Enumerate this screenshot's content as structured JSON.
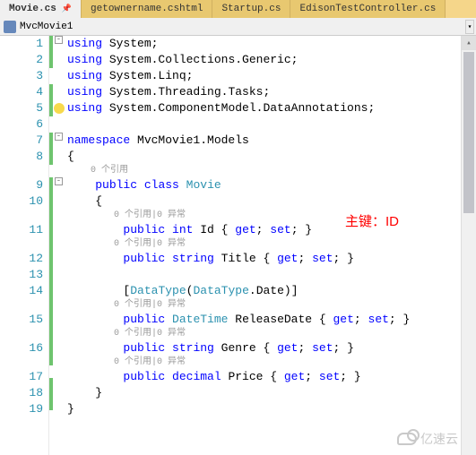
{
  "tabs": [
    {
      "label": "Movie.cs",
      "active": true,
      "pinned": true
    },
    {
      "label": "getownername.cshtml",
      "active": false,
      "pinned": false
    },
    {
      "label": "Startup.cs",
      "active": false,
      "pinned": false
    },
    {
      "label": "EdisonTestController.cs",
      "active": false,
      "pinned": false
    }
  ],
  "breadcrumb": {
    "project": "MvcMovie1"
  },
  "annotation": "主键：ID",
  "watermark": "亿速云",
  "lens": {
    "ref0": "0 个引用",
    "refex": "0 个引用|0 异常"
  },
  "code": {
    "l1": {
      "kw": "using",
      "ns": " System;"
    },
    "l2": {
      "kw": "using",
      "ns": " System.Collections.Generic;"
    },
    "l3": {
      "kw": "using",
      "ns": " System.Linq;"
    },
    "l4": {
      "kw": "using",
      "ns": " System.Threading.Tasks;"
    },
    "l5": {
      "kw": "using",
      "ns": " System.ComponentModel.DataAnnotations;"
    },
    "l7a": "namespace",
    "l7b": " MvcMovie1.Models",
    "l8": "{",
    "l9a": "public",
    "l9b": "class",
    "l9c": "Movie",
    "l10": "{",
    "l11a": "public",
    "l11b": "int",
    "l11c": " Id { ",
    "l11d": "get",
    "l11e": "; ",
    "l11f": "set",
    "l11g": "; }",
    "l12a": "public",
    "l12b": "string",
    "l12c": " Title { ",
    "l12d": "get",
    "l12e": "; ",
    "l12f": "set",
    "l12g": "; }",
    "l14a": "[",
    "l14b": "DataType",
    "l14c": "(",
    "l14d": "DataType",
    "l14e": ".Date)]",
    "l15a": "public",
    "l15b": "DateTime",
    "l15c": " ReleaseDate { ",
    "l15d": "get",
    "l15e": "; ",
    "l15f": "set",
    "l15g": "; }",
    "l16a": "public",
    "l16b": "string",
    "l16c": " Genre { ",
    "l16d": "get",
    "l16e": "; ",
    "l16f": "set",
    "l16g": "; }",
    "l17a": "public",
    "l17b": "decimal",
    "l17c": " Price { ",
    "l17d": "get",
    "l17e": "; ",
    "l17f": "set",
    "l17g": "; }",
    "l18": "}",
    "l19": "}"
  },
  "lines": [
    "1",
    "2",
    "3",
    "4",
    "5",
    "6",
    "7",
    "8",
    "9",
    "10",
    "11",
    "12",
    "13",
    "14",
    "15",
    "16",
    "17",
    "18",
    "19"
  ]
}
